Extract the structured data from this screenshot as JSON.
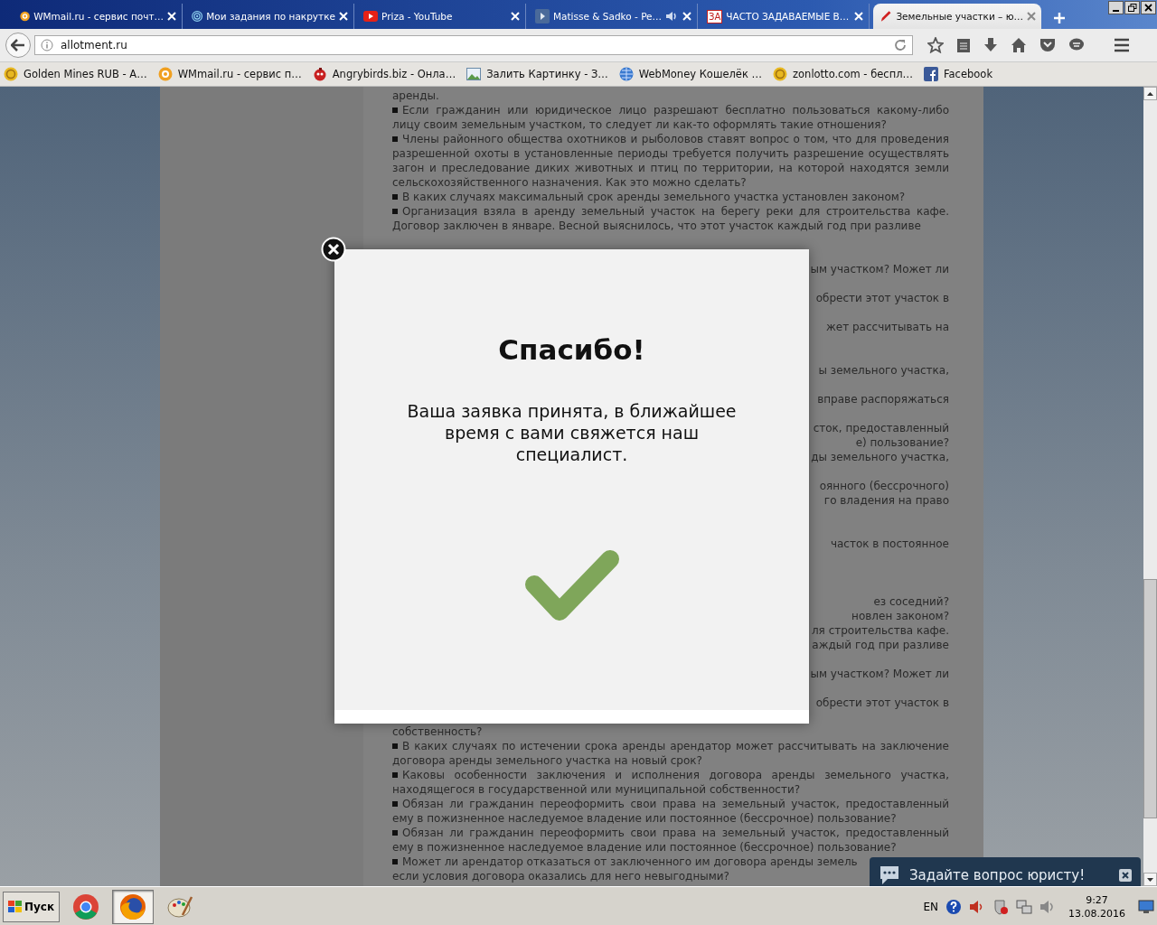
{
  "tabs": [
    {
      "title": "WMmail.ru - сервис почт…",
      "selected": false,
      "audio": false
    },
    {
      "title": "Мои задания по накрутке",
      "selected": false,
      "audio": false
    },
    {
      "title": "Priza - YouTube",
      "selected": false,
      "audio": false
    },
    {
      "title": "Matisse & Sadko - Pe…",
      "selected": false,
      "audio": true
    },
    {
      "title": "ЧАСТО ЗАДАВАЕМЫЕ В…",
      "badge": "ЗА",
      "selected": false,
      "audio": false
    },
    {
      "title": "Земельные участки – ю…",
      "selected": true,
      "audio": false
    }
  ],
  "address_bar": {
    "url": "allotment.ru"
  },
  "bookmarks": [
    {
      "title": "Golden Mines RUB - А…"
    },
    {
      "title": "WMmail.ru - сервис п…"
    },
    {
      "title": "Angrybirds.biz - Онла…"
    },
    {
      "title": "Залить Картинку - З…"
    },
    {
      "title": "WebMoney Кошелёк …"
    },
    {
      "title": "zonlotto.com - беспл…"
    },
    {
      "title": "Facebook"
    }
  ],
  "article": {
    "paragraphs_top": [
      {
        "kind": "continuation",
        "text": "аренды."
      },
      {
        "kind": "question",
        "text": "Если гражданин или юридическое лицо разрешают бесплатно пользоваться какому-либо лицу своим земельным участком, то следует ли как-то оформлять такие отношения?"
      },
      {
        "kind": "question",
        "text": "Члены районного общества охотников и рыболовов ставят вопрос о том, что для проведения разрешенной охоты в установленные периоды требуется получить разрешение осуществлять загон и преследование диких животных и птиц по территории, на которой находятся земли сельскохозяйственного назначения. Как это можно сделать?"
      },
      {
        "kind": "question",
        "text": "В каких случаях максимальный срок аренды земельного участка установлен законом?"
      },
      {
        "kind": "question",
        "text": "Организация взяла в аренду земельный участок на берегу реки для строительства кафе. Договор заключен в январе. Весной выяснилось, что этот участок каждый год при разливе"
      }
    ],
    "fragments_right_of_dialog": [
      "ым участком? Может ли",
      "обрести этот участок в",
      "жет рассчитывать на",
      "ы земельного участка,",
      "вправе распоряжаться",
      "сток, предоставленный",
      "е) пользование?",
      "ды земельного участка,",
      "оянного (бессрочного)",
      "го владения на право",
      "часток в постоянное",
      "ез соседний?",
      "новлен законом?",
      "ля строительства кафе.",
      "аждый год при разливе",
      "ым участком? Может ли",
      "обрести этот участок в"
    ],
    "paragraphs_bottom": [
      {
        "kind": "continuation",
        "text": "собственность?"
      },
      {
        "kind": "question",
        "text": "В каких случаях по истечении срока аренды арендатор может рассчитывать на заключение договора аренды земельного участка на новый срок?"
      },
      {
        "kind": "question",
        "text": "Каковы особенности заключения и исполнения договора аренды земельного участка, находящегося в государственной или муниципальной собственности?"
      },
      {
        "kind": "question",
        "text": "Обязан ли гражданин переоформить свои права на земельный участок, предоставленный ему в пожизненное наследуемое владение или постоянное (бессрочное) пользование?"
      },
      {
        "kind": "question",
        "text": "Обязан ли гражданин переоформить свои права на земельный участок, предоставленный ему в пожизненное наследуемое владение или постоянное (бессрочное) пользование?"
      },
      {
        "kind": "question",
        "text": "Может ли арендатор отказаться от заключенного им договора аренды земель\nесли условия договора оказались для него невыгодными?"
      }
    ]
  },
  "dialog": {
    "title": "Спасибо!",
    "message": "Ваша заявка принята, в ближайшее время с вами свяжется наш специалист."
  },
  "chat_widget": {
    "label": "Задайте вопрос юристу!"
  },
  "taskbar": {
    "start": "Пуск",
    "apps": [
      {
        "selected": false
      },
      {
        "selected": true
      },
      {
        "selected": false
      }
    ],
    "language": "EN",
    "time": "9:27",
    "date": "13.08.2016"
  }
}
